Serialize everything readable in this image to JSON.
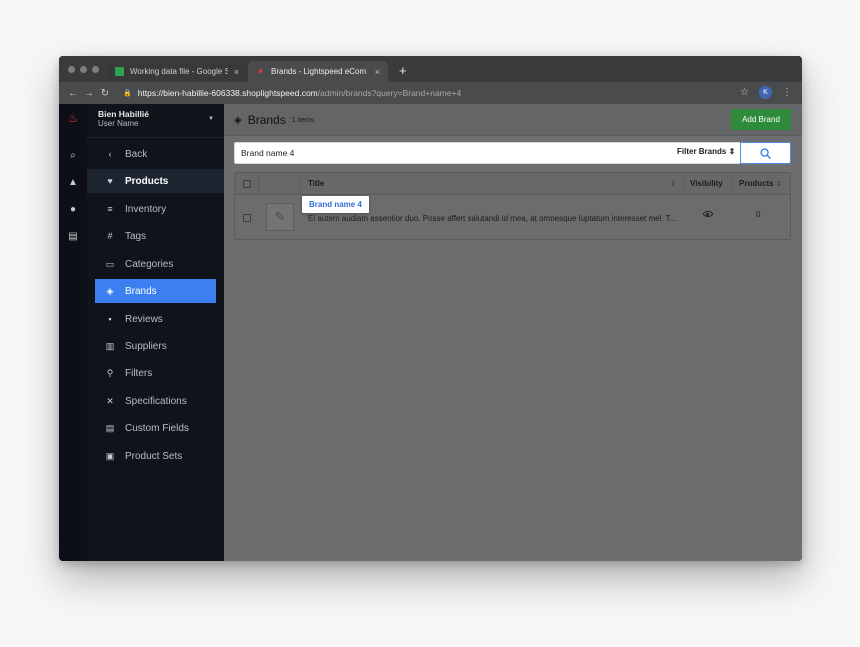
{
  "browser": {
    "tabs": [
      {
        "title": "Working data file - Google Sheets",
        "favicon_color": "#2ea44f",
        "active": false
      },
      {
        "title": "Brands - Lightspeed eCom",
        "favicon_color": "#e8392f",
        "active": true
      }
    ],
    "close_glyph": "×",
    "new_tab_glyph": "+",
    "url_host": "https://bien-habillie-606338.shoplightspeed.com",
    "url_path": "/admin/brands?query=Brand+name+4",
    "profile_initial": "K"
  },
  "store": {
    "name": "Bien Habillié",
    "user": "User Name"
  },
  "rail": {
    "icons": [
      "logo-flame-icon",
      "search-icon",
      "bell-icon",
      "help-icon",
      "card-icon"
    ]
  },
  "sidebar": {
    "back_label": "Back",
    "products_label": "Products",
    "items": [
      {
        "label": "Inventory",
        "icon": "≡"
      },
      {
        "label": "Tags",
        "icon": "#"
      },
      {
        "label": "Categories",
        "icon": "▭"
      },
      {
        "label": "Brands",
        "icon": "◈",
        "active": true
      },
      {
        "label": "Reviews",
        "icon": "▪"
      },
      {
        "label": "Suppliers",
        "icon": "▥"
      },
      {
        "label": "Filters",
        "icon": "⚲"
      },
      {
        "label": "Specifications",
        "icon": "✕"
      },
      {
        "label": "Custom Fields",
        "icon": "▤"
      },
      {
        "label": "Product Sets",
        "icon": "▣"
      }
    ]
  },
  "header": {
    "title": "Brands",
    "count": "1 items",
    "add_button": "Add Brand"
  },
  "search": {
    "value": "Brand name 4",
    "filter_label": "Filter Brands"
  },
  "table": {
    "columns": {
      "title": "Title",
      "visibility": "Visibility",
      "products": "Products"
    },
    "rows": [
      {
        "title": "Brand name 4",
        "description": "Ei autem audiam assentior duo. Posse affert salutandi id mea, at omnesque luptatum interesset mel. T...",
        "visible": true,
        "products": "0"
      }
    ]
  },
  "colors": {
    "accent": "#3b7ff0",
    "add_button": "#2e8b3b",
    "link": "#2f6fd1",
    "sidebar_bg": "#0f141b"
  }
}
